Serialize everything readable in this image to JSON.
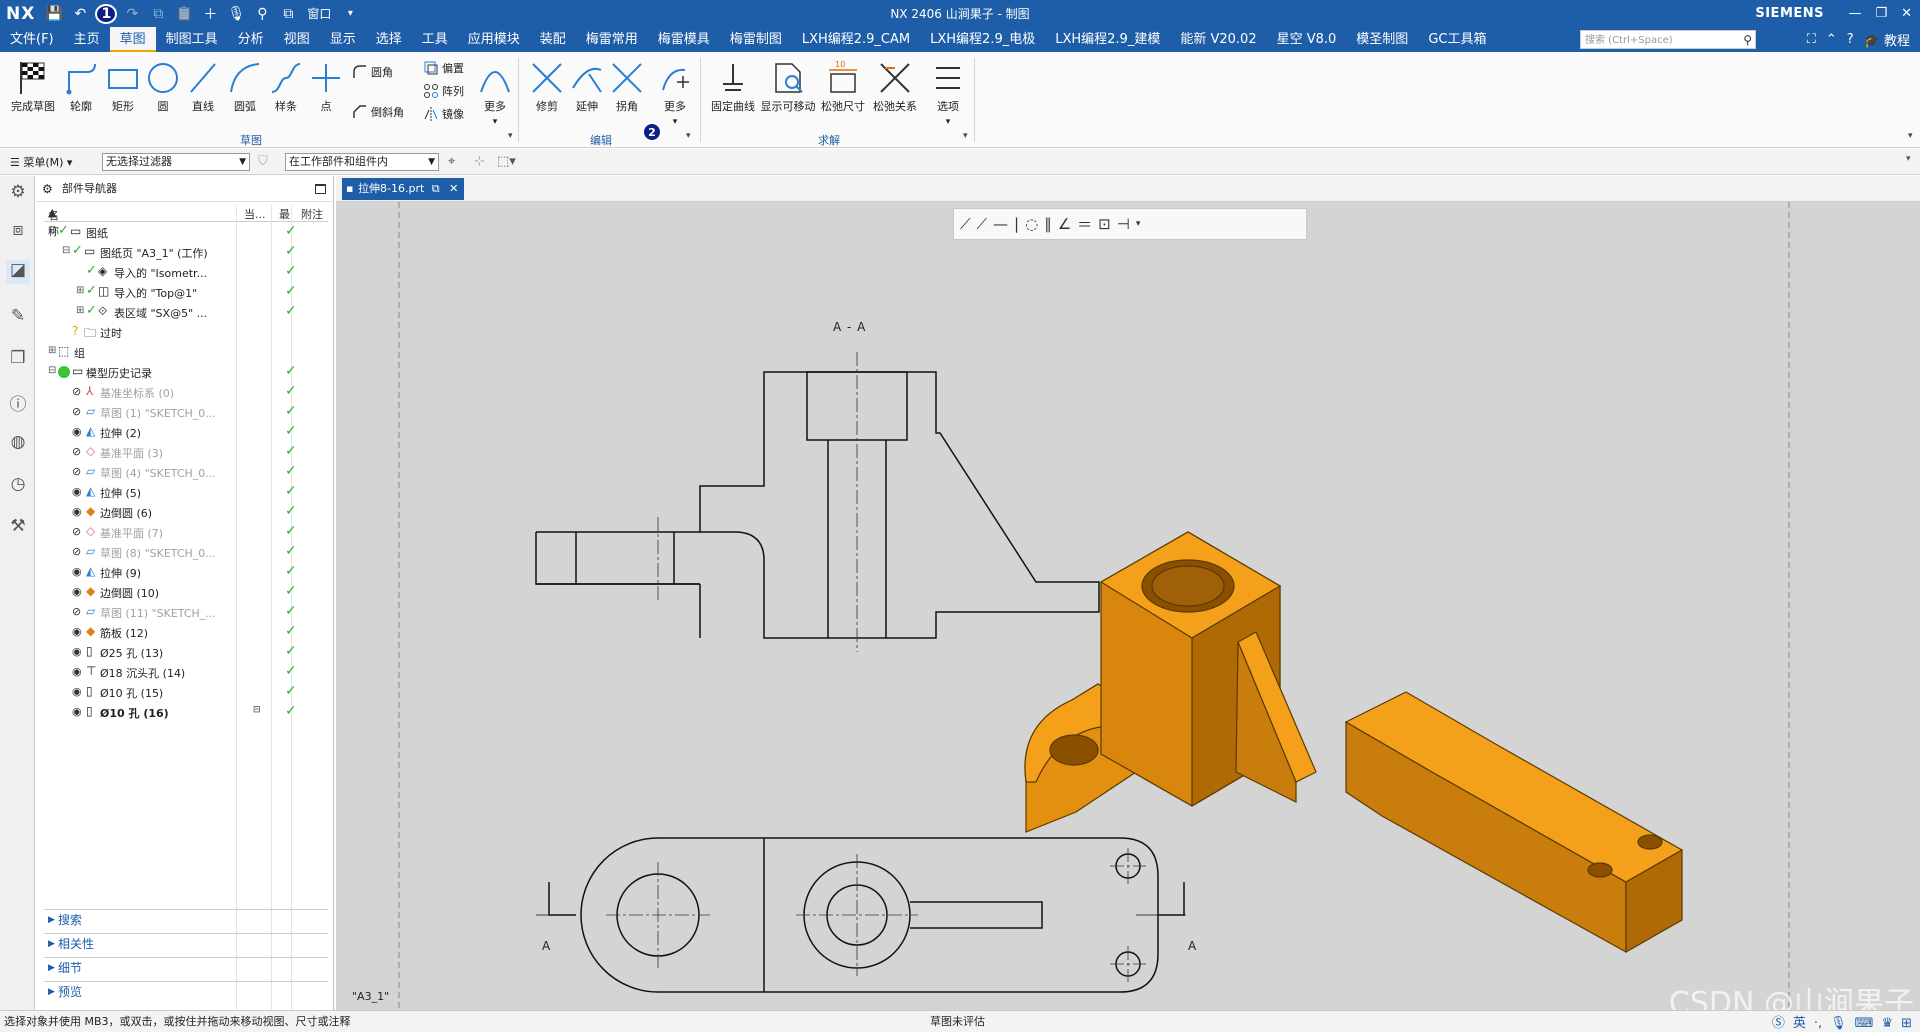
{
  "titlebar": {
    "logo": "NX",
    "title": "NX 2406 山涧果子 - 制图",
    "brand": "SIEMENS",
    "window_label": "窗口"
  },
  "menu": {
    "tabs": [
      "文件(F)",
      "主页",
      "草图",
      "制图工具",
      "分析",
      "视图",
      "显示",
      "选择",
      "工具",
      "应用模块",
      "装配",
      "梅雷常用",
      "梅雷模具",
      "梅雷制图",
      "LXH编程2.9_CAM",
      "LXH编程2.9_电极",
      "LXH编程2.9_建模",
      "能新 V20.02",
      "星空 V8.0",
      "模圣制图",
      "GC工具箱"
    ],
    "active_tab": "草图",
    "search_placeholder": "搜索 (Ctrl+Space)",
    "tutorial": "教程"
  },
  "badges": {
    "one": "1",
    "two": "2"
  },
  "ribbon": {
    "sketch_group": "草图",
    "edit_group": "编辑",
    "solve_group": "求解",
    "buttons": {
      "finish": "完成草图",
      "profile": "轮廓",
      "rect": "矩形",
      "circle": "圆",
      "line": "直线",
      "arc": "圆弧",
      "spline": "样条",
      "point": "点",
      "fillet": "圆角",
      "chamfer": "倒斜角",
      "offset": "偏置",
      "pattern": "阵列",
      "mirror": "镜像",
      "more1": "更多",
      "trim": "修剪",
      "extend": "延伸",
      "corner": "拐角",
      "more2": "更多",
      "fixed": "固定曲线",
      "show_movable": "显示可移动",
      "relax_dim": "松弛尺寸",
      "relax_rel": "松弛关系",
      "options": "选项"
    }
  },
  "filterbar": {
    "menu": "菜单(M)",
    "filter": "无选择过滤器",
    "scope": "在工作部件和组件内"
  },
  "navigator": {
    "title": "部件导航器",
    "columns": {
      "name": "名称",
      "current": "当...",
      "latest": "最",
      "attach": "附注"
    },
    "rows": [
      {
        "label": "图纸",
        "check": "✓"
      },
      {
        "label": "图纸页 \"A3_1\" (工作)",
        "check": "✓"
      },
      {
        "label": "导入的 \"Isometr...",
        "check": "✓"
      },
      {
        "label": "导入的 \"Top@1\"",
        "check": "✓"
      },
      {
        "label": "表区域 \"SX@5\" ...",
        "check": "✓"
      },
      {
        "label": "过时",
        "check": ""
      },
      {
        "label": "组",
        "check": ""
      },
      {
        "label": "模型历史记录",
        "check": "✓"
      },
      {
        "label": "基准坐标系 (0)",
        "check": "✓"
      },
      {
        "label": "草图 (1) \"SKETCH_0...",
        "check": "✓"
      },
      {
        "label": "拉伸 (2)",
        "check": "✓"
      },
      {
        "label": "基准平面 (3)",
        "check": "✓"
      },
      {
        "label": "草图 (4) \"SKETCH_0...",
        "check": "✓"
      },
      {
        "label": "拉伸 (5)",
        "check": "✓"
      },
      {
        "label": "边倒圆 (6)",
        "check": "✓"
      },
      {
        "label": "基准平面 (7)",
        "check": "✓"
      },
      {
        "label": "草图 (8) \"SKETCH_0...",
        "check": "✓"
      },
      {
        "label": "拉伸 (9)",
        "check": "✓"
      },
      {
        "label": "边倒圆 (10)",
        "check": "✓"
      },
      {
        "label": "草图 (11) \"SKETCH_...",
        "check": "✓"
      },
      {
        "label": "筋板 (12)",
        "check": "✓"
      },
      {
        "label": "Ø25 孔 (13)",
        "check": "✓"
      },
      {
        "label": "Ø18 沉头孔 (14)",
        "check": "✓"
      },
      {
        "label": "Ø10 孔 (15)",
        "check": "✓"
      },
      {
        "label": "Ø10 孔 (16)",
        "check": "✓"
      }
    ],
    "panels": [
      "搜索",
      "相关性",
      "细节",
      "预览"
    ]
  },
  "document_tab": "拉伸8-16.prt",
  "drawing": {
    "section_label": "A - A",
    "cut_label_left": "A",
    "cut_label_right": "A",
    "sheet_name": "\"A3_1\"",
    "watermark": "CSDN @山涧果子",
    "part_color": "#f5a01a"
  },
  "statusbar": {
    "left": "选择对象并使用 MB3，或双击，或按住并拖动来移动视图、尺寸或注释",
    "mid": "草图未评估",
    "ime": "英"
  }
}
